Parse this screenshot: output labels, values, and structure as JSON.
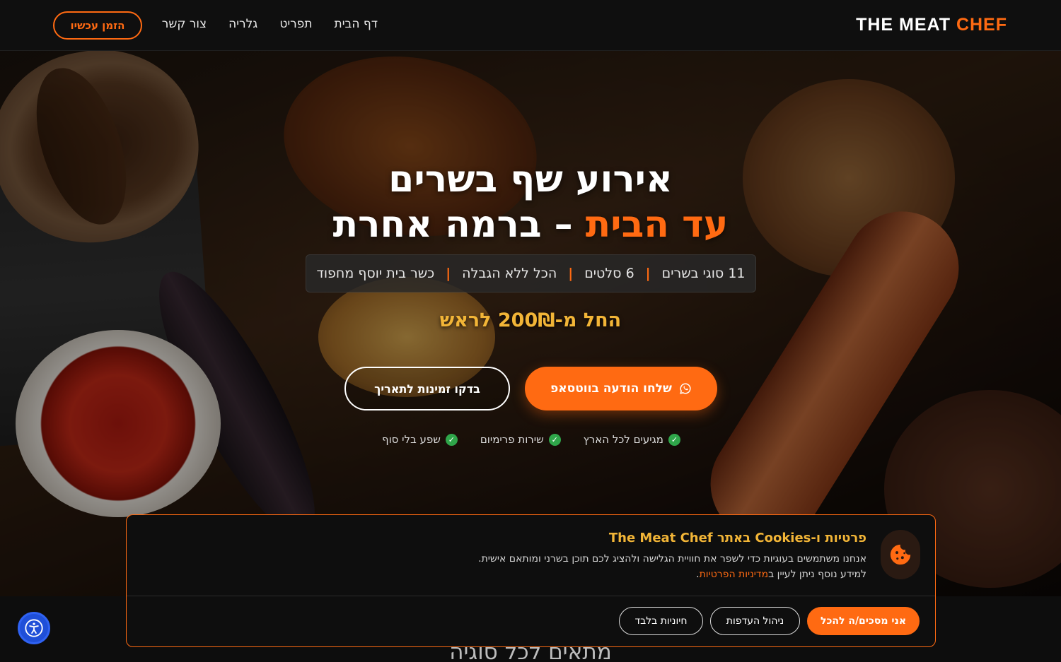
{
  "nav": {
    "logo_main": "THE MEAT ",
    "logo_accent": "CHEF",
    "links": [
      "דף הבית",
      "תפריט",
      "גלריה",
      "צור קשר"
    ],
    "order_button": "הזמן עכשיו"
  },
  "hero": {
    "title_line1": "אירוע שף בשרים",
    "title_line2_accent": "עד הבית",
    "title_line2_rest": " – ברמה אחרת",
    "features": [
      "11 סוגי בשרים",
      "6 סלטים",
      "הכל ללא הגבלה",
      "כשר בית יוסף מחפוד"
    ],
    "feature_separator": "|",
    "price": "החל מ-200₪ לראש",
    "whatsapp_button": "שלחו הודעה בווטסאפ",
    "check_button": "בדקו זמינות לתאריך",
    "checks": [
      "מגיעים לכל הארץ",
      "שירות פרימיום",
      "שפע בלי סוף"
    ]
  },
  "next_section_title": "מתאים לכל סוגיה",
  "cookie": {
    "title": "פרטיות ו-Cookies באתר The Meat Chef",
    "text_line1": "אנחנו משתמשים בעוגיות כדי לשפר את חוויית הגלישה ולהציג לכם תוכן בשרני ומותאם אישית.",
    "text_line2_prefix": "למידע נוסף ניתן לעיין ב",
    "policy_link": "מדיניות הפרטיות",
    "text_line2_suffix": ".",
    "accept_button": "אני מסכים/ה להכל",
    "manage_button": "ניהול העדפות",
    "essential_button": "חיוניות בלבד"
  },
  "colors": {
    "accent": "#ff6a12",
    "gold": "#f2b537",
    "check_green": "#2fa64a",
    "a11y_blue": "#1f4fd8"
  },
  "icons": {
    "whatsapp": "whatsapp-icon",
    "check": "check-circle-icon",
    "cookie": "cookie-icon",
    "accessibility": "accessibility-icon"
  }
}
